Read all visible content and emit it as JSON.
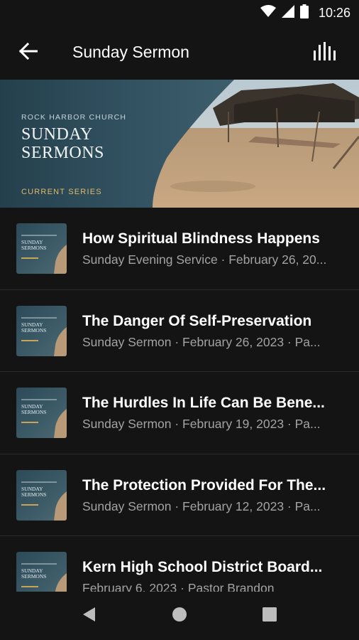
{
  "status_bar": {
    "time": "10:26"
  },
  "app_bar": {
    "title": "Sunday Sermon"
  },
  "hero": {
    "church": "ROCK HARBOR CHURCH",
    "title": "SUNDAY SERMONS",
    "series": "CURRENT SERIES"
  },
  "thumb": {
    "title": "SUNDAY SERMONS"
  },
  "sermons": [
    {
      "title": "How Spiritual Blindness Happens",
      "subtitle": "Sunday Evening Service · February 26, 20..."
    },
    {
      "title": "The Danger Of Self-Preservation",
      "subtitle": "Sunday Sermon · February 26, 2023 · Pa..."
    },
    {
      "title": "The Hurdles In Life Can Be Bene...",
      "subtitle": "Sunday Sermon · February 19, 2023 · Pa..."
    },
    {
      "title": "The Protection Provided For The...",
      "subtitle": "Sunday Sermon · February 12, 2023 · Pa..."
    },
    {
      "title": "Kern High School District Board...",
      "subtitle": "February 6, 2023 · Pastor Brandon"
    }
  ],
  "icons": {
    "wifi": "wifi-icon",
    "signal": "signal-icon",
    "battery": "battery-icon",
    "back": "arrow-back-icon",
    "equalizer": "equalizer-icon",
    "nav_back": "triangle-back-icon",
    "nav_home": "circle-home-icon",
    "nav_recents": "square-recents-icon"
  },
  "colors": {
    "background": "#141414",
    "accent_gold": "#e0b968",
    "subtitle_gray": "#a3a3a3"
  }
}
